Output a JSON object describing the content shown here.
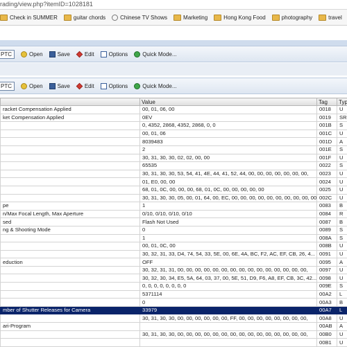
{
  "browser": {
    "url": "rading/view.php?itemID=1028181",
    "bookmarks": [
      "Check in SUMMER",
      "guitar chords",
      "Chinese TV Shows",
      "Marketing",
      "Hong Kong Food",
      "photography",
      "travel"
    ]
  },
  "toolbar1": {
    "ptc": "PTC",
    "open": "Open",
    "save": "Save",
    "edit": "Edit",
    "options": "Options",
    "quick": "Quick Mode..."
  },
  "toolbar2": {
    "ptc": "PTC",
    "open": "Open",
    "save": "Save",
    "edit": "Edit",
    "options": "Options",
    "quick": "Quick Mode..."
  },
  "table": {
    "headers": [
      "",
      "Value",
      "Tag",
      "Type"
    ],
    "rows": [
      [
        "racket Compensation Applied",
        "00, 01, 06, 00",
        "0018",
        "U"
      ],
      [
        "ket Compensation Applied",
        "0EV",
        "0019",
        "SR"
      ],
      [
        "",
        "0, 4352, 2868, 4352, 2868, 0, 0",
        "001B",
        "S"
      ],
      [
        "",
        "00, 01, 06",
        "001C",
        "U"
      ],
      [
        "",
        "8039483",
        "001D",
        "A"
      ],
      [
        "",
        "2",
        "001E",
        "S"
      ],
      [
        "",
        "30, 31, 30, 30, 02, 02, 00, 00",
        "001F",
        "U"
      ],
      [
        "",
        "65535",
        "0022",
        "S"
      ],
      [
        "",
        "30, 31, 30, 30, 53, 54, 41, 4E, 44, 41, 52, 44, 00, 00, 00, 00, 00, 00, 00,",
        "0023",
        "U"
      ],
      [
        "",
        "01, E0, 00, 00",
        "0024",
        "U"
      ],
      [
        "",
        "68, 01, 0C, 00, 00, 00, 68, 01, 0C, 00, 00, 00, 00, 00",
        "0025",
        "U"
      ],
      [
        "",
        "30, 31, 30, 30, 05, 00, 01, 64, 00, EC, 00, 00, 00, 00, 00, 00, 00, 00, 00, 00, 02C,",
        "002C",
        "U"
      ],
      [
        "pe",
        "1",
        "0083",
        "B"
      ],
      [
        "n/Max Focal Length, Max Aperture",
        "0/10, 0/10, 0/10, 0/10",
        "0084",
        "R"
      ],
      [
        "sed",
        "Flash Not Used",
        "0087",
        "B"
      ],
      [
        "ng & Shooting Mode",
        "0",
        "0089",
        "S"
      ],
      [
        "",
        "1",
        "008A",
        "S"
      ],
      [
        "",
        "00, 01, 0C, 00",
        "008B",
        "U"
      ],
      [
        "",
        "30, 32, 31, 33, D4, 74, 54, 33, 5E, 00, 6E, 4A, BC, F2, AC, EF, CB, 26, 4...",
        "0091",
        "U"
      ],
      [
        "eduction",
        "OFF",
        "0095",
        "A"
      ],
      [
        "",
        "30, 32, 31, 31, 00, 00, 00, 00, 00, 00, 00, 00, 00, 00, 00, 00, 00, 00, 00,",
        "0097",
        "U"
      ],
      [
        "",
        "30, 32, 30, 34, E5, 5A, 64, 03, 37, 00, 5E, 51, D9, F6, A8, EF, CB, 3C, 42...",
        "0098",
        "U"
      ],
      [
        "",
        "0, 0, 0, 0, 0, 0, 0, 0",
        "009E",
        "S"
      ],
      [
        "",
        "5371114",
        "00A2",
        "L"
      ],
      [
        "",
        "0",
        "00A3",
        "B"
      ],
      [
        "mber of Shutter Releases for Camera",
        "33979",
        "00A7",
        "L"
      ],
      [
        "",
        "30, 31, 30, 30, 00, 00, 00, 00, 00, 00, FF, 00, 00, 00, 00, 00, 00, 00, 00,",
        "00A8",
        "U"
      ],
      [
        "ari-Program",
        "",
        "00AB",
        "A"
      ],
      [
        "",
        "30, 31, 30, 30, 00, 00, 00, 00, 00, 00, 00, 00, 00, 00, 00, 00, 00, 00, 00,",
        "00B0",
        "U"
      ],
      [
        "",
        "",
        "00B1",
        "U"
      ]
    ],
    "selected_index": 25
  }
}
